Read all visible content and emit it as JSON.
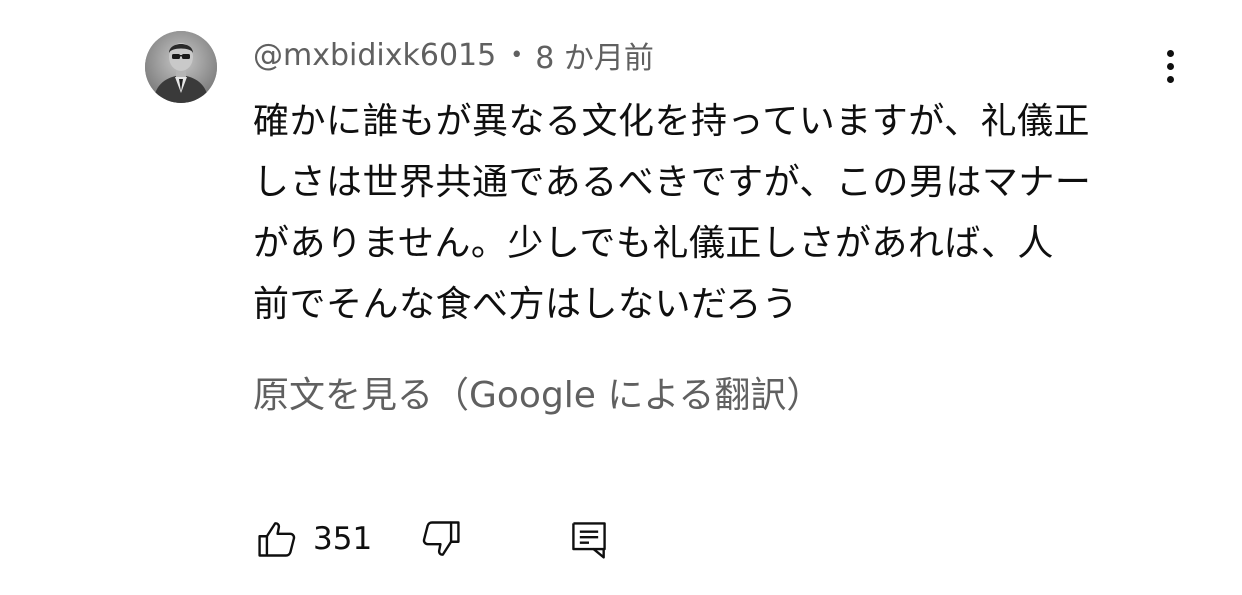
{
  "comment": {
    "author": "@mxbidixk6015",
    "separator": "•",
    "time": "8 か月前",
    "text_lines": [
      "確かに誰もが異なる文化を持っていますが、礼儀正",
      "しさは世界共通であるべきですが、この男はマナー",
      "がありません。少しでも礼儀正しさがあれば、人",
      "前でそんな食べ方はしないだろう"
    ],
    "translation_link": "原文を見る（Google による翻訳）",
    "like_count": "351"
  },
  "icons": {
    "avatar": "avatar-photo",
    "menu": "more-vert-icon",
    "like": "thumb-up-icon",
    "dislike": "thumb-down-icon",
    "reply": "reply-comment-icon"
  },
  "colors": {
    "text_primary": "#0f0f0f",
    "text_secondary": "#606060",
    "background": "#ffffff"
  }
}
